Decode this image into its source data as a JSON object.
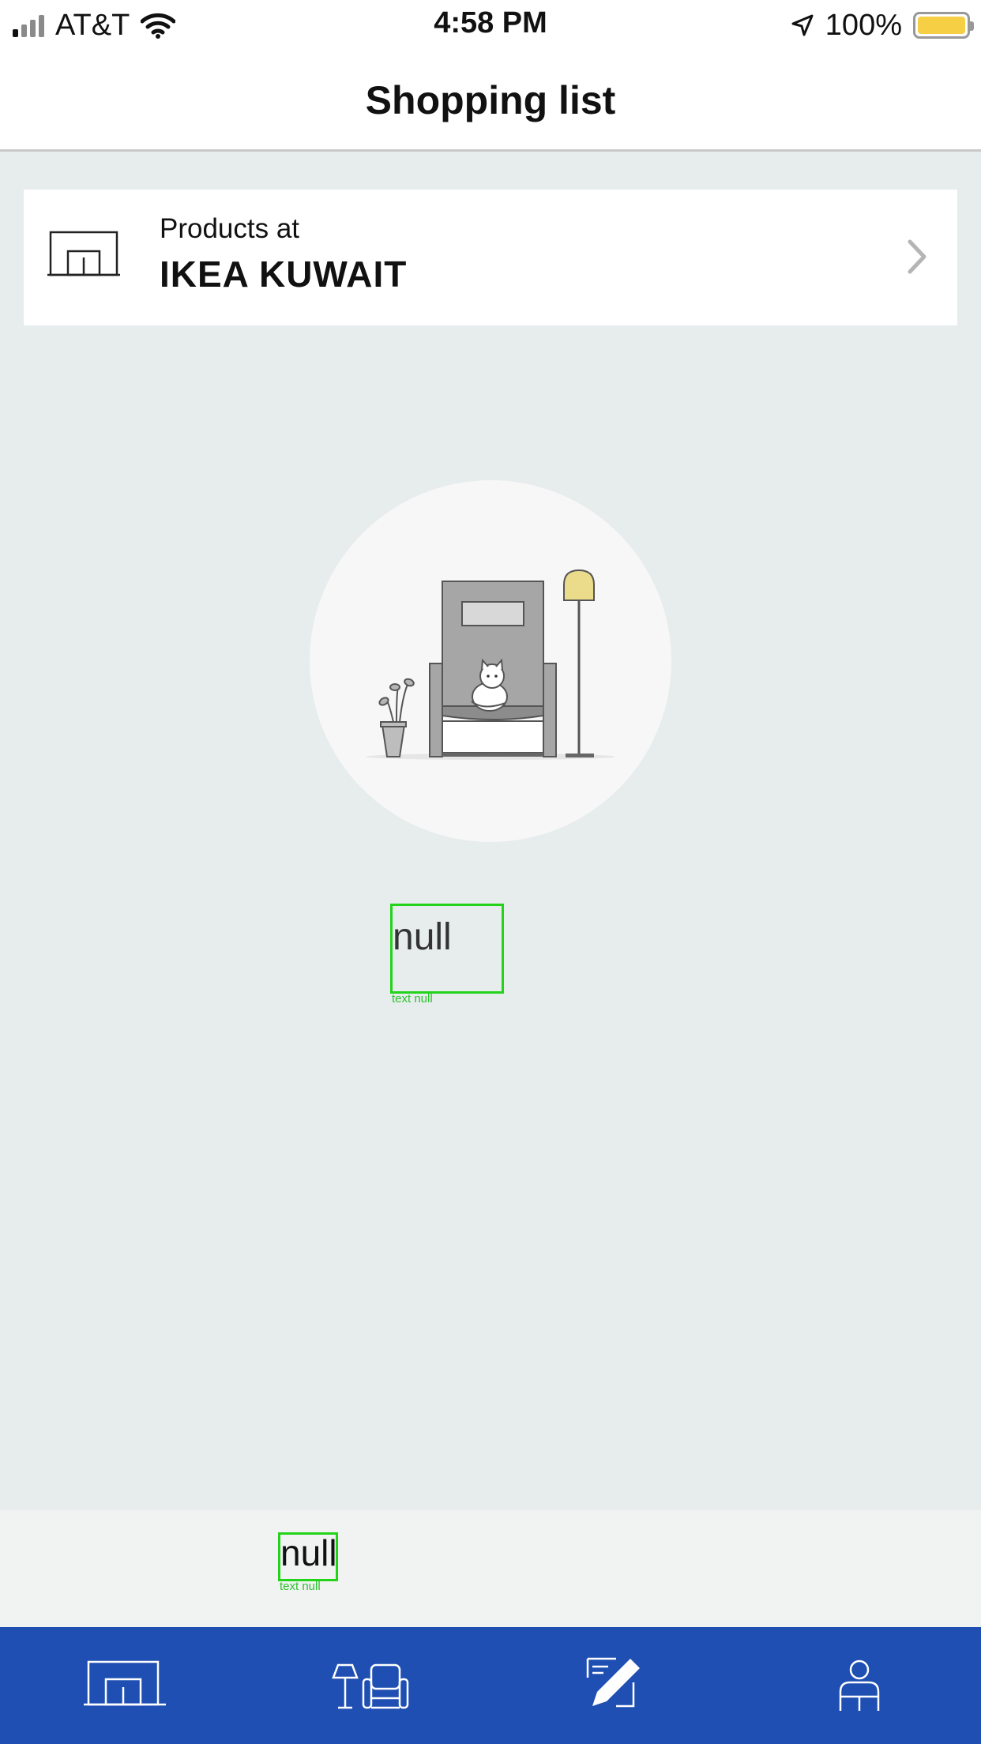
{
  "status_bar": {
    "carrier": "AT&T",
    "time": "4:58 PM",
    "battery_percent": "100%"
  },
  "header": {
    "title": "Shopping list"
  },
  "store": {
    "subtitle": "Products at",
    "name": "IKEA KUWAIT"
  },
  "empty_state": {
    "text": "null",
    "caption": "text null"
  },
  "bottom_panel": {
    "text": "null",
    "caption": "text null"
  },
  "tabs": [
    {
      "icon": "store-icon"
    },
    {
      "icon": "furniture-icon"
    },
    {
      "icon": "shopping-list-icon"
    },
    {
      "icon": "profile-icon"
    }
  ],
  "colors": {
    "tab_bar": "#1f4fb2",
    "background": "#e7ecec",
    "highlight_box": "#22d31a",
    "battery": "#f6cf44"
  }
}
